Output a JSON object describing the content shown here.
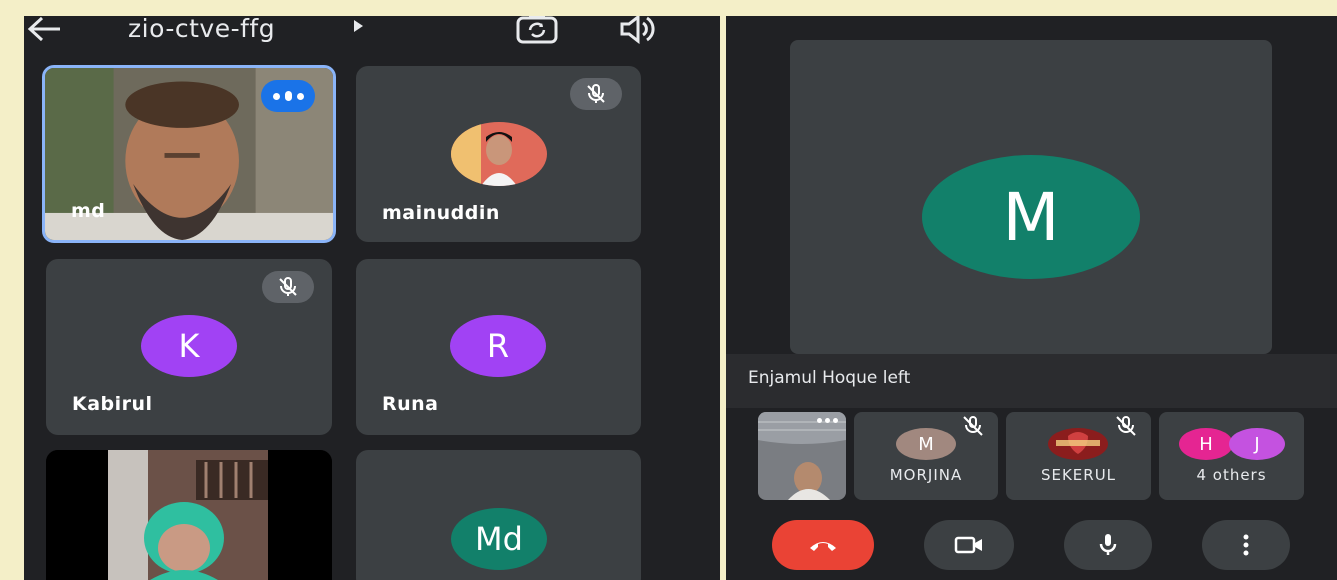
{
  "left": {
    "meeting_code": "zio-ctve-ffg",
    "tiles": [
      {
        "name": "md"
      },
      {
        "name": "mainuddin"
      },
      {
        "name": "Kabirul",
        "initial": "K"
      },
      {
        "name": "Runa",
        "initial": "R"
      },
      {
        "name": ""
      },
      {
        "name": "",
        "initial": "Md"
      }
    ]
  },
  "right": {
    "main_initial": "M",
    "notice": "Enjamul Hoque left",
    "participants": [
      {
        "name": "MORJINA",
        "initial": "M"
      },
      {
        "name": "SEKERUL"
      },
      {
        "name": "4 others",
        "initials": [
          "H",
          "J"
        ]
      }
    ]
  },
  "colors": {
    "panel_bg": "#202124",
    "tile_bg": "#3c4043",
    "purple_avatar": "#a142f4",
    "teal_avatar": "#12806a",
    "end_call_red": "#ea4335",
    "self_border": "#8ab4f8",
    "speaking_blue": "#1a73e8"
  },
  "icons": [
    "back-arrow-icon",
    "dropdown-arrow-icon",
    "switch-camera-icon",
    "speaker-icon",
    "mic-off-icon",
    "speaking-indicator-icon",
    "end-call-icon",
    "camera-icon",
    "mic-icon",
    "more-vert-icon"
  ]
}
